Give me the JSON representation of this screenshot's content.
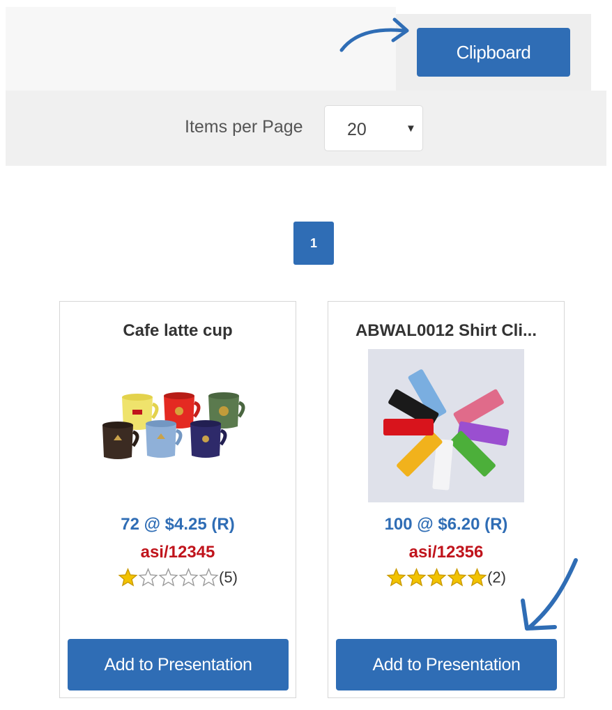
{
  "toolbar": {
    "clipboard_label": "Clipboard"
  },
  "pagination_bar": {
    "items_per_page_label": "Items per Page",
    "items_per_page_value": "20",
    "current_page": "1"
  },
  "products": [
    {
      "title": "Cafe latte cup",
      "price": "72 @ $4.25 (R)",
      "code": "asi/12345",
      "rating": 1,
      "rating_max": 5,
      "review_count": "(5)",
      "add_label": "Add to Presentation"
    },
    {
      "title": "ABWAL0012 Shirt Cli...",
      "price": "100 @ $6.20 (R)",
      "code": "asi/12356",
      "rating": 5,
      "rating_max": 5,
      "review_count": "(2)",
      "add_label": "Add to Presentation"
    }
  ],
  "colors": {
    "primary_blue": "#2f6db5",
    "code_red": "#c0141c",
    "star_gold": "#f2c200",
    "annotation_arrow": "#2f6db5"
  },
  "icons": {
    "annotation_top": "curved-arrow-right-icon",
    "annotation_bottom": "arrow-down-left-icon",
    "select": "caret-down-icon",
    "rating": "star-icon"
  }
}
